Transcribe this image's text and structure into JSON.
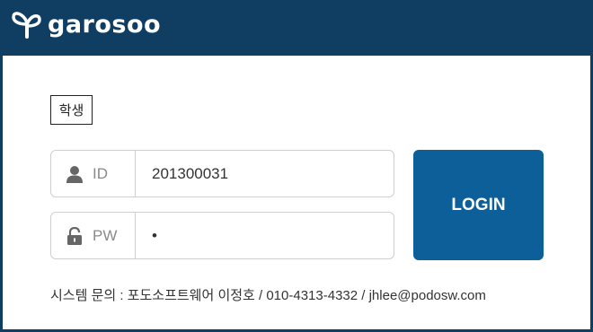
{
  "header": {
    "logo_text": "garosoo",
    "logo_icon": "sprout-icon"
  },
  "role": {
    "label": "학생"
  },
  "login_form": {
    "id_field": {
      "label": "ID",
      "value": "201300031",
      "icon": "user-icon"
    },
    "pw_field": {
      "label": "PW",
      "value": "•",
      "icon": "lock-icon"
    },
    "login_button": "LOGIN"
  },
  "footer": {
    "contact": "시스템 문의 : 포도소프트웨어 이정호 / 010-4313-4332 / jhlee@podosw.com"
  },
  "colors": {
    "header_bg": "#0f3e62",
    "button_bg": "#0d5f99"
  }
}
